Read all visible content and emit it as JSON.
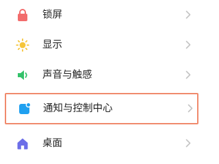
{
  "settings": {
    "items": [
      {
        "label": "锁屏",
        "icon": "lock-icon",
        "color": "#f26c6c"
      },
      {
        "label": "显示",
        "icon": "sun-icon",
        "color": "#f5c53a"
      },
      {
        "label": "声音与触感",
        "icon": "speaker-icon",
        "color": "#34c26a"
      },
      {
        "label": "通知与控制中心",
        "icon": "notification-icon",
        "color": "#1fa0f0",
        "highlighted": true
      },
      {
        "label": "桌面",
        "icon": "home-icon",
        "color": "#6c6ee8"
      }
    ]
  },
  "colors": {
    "highlight_border": "#f08a6c",
    "chevron": "#c4c4c4",
    "text": "#1f1f1f"
  }
}
